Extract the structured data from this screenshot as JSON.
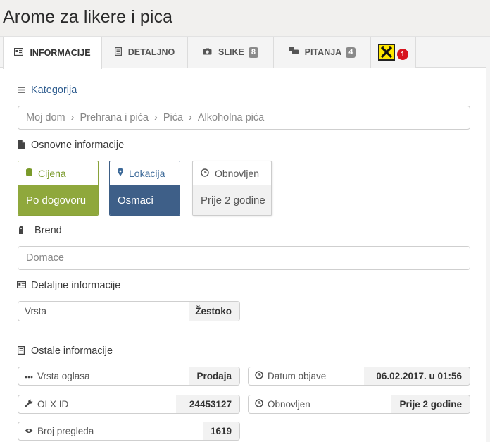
{
  "title": "Arome za likere i pica",
  "tabs": [
    {
      "label": "INFORMACIJE",
      "icon": "id-card-icon"
    },
    {
      "label": "DETALJNO",
      "icon": "document-icon"
    },
    {
      "label": "SLIKE",
      "icon": "camera-icon",
      "badge": "8"
    },
    {
      "label": "PITANJA",
      "icon": "chat-icon",
      "badge": "4"
    },
    {
      "label": "",
      "icon": "raiffeisen-logo-icon",
      "badge": "1"
    }
  ],
  "kategorija": {
    "label": "Kategorija",
    "breadcrumb": [
      "Moj dom",
      "Prehrana i pića",
      "Pića",
      "Alkoholna pića"
    ],
    "separator": "›"
  },
  "osnovne": {
    "label": "Osnovne informacije",
    "cijena": {
      "label": "Cijena",
      "value": "Po dogovoru"
    },
    "lokacija": {
      "label": "Lokacija",
      "value": "Osmaci"
    },
    "obnovljen": {
      "label": "Obnovljen",
      "value": "Prije 2 godine"
    }
  },
  "brend": {
    "label": "Brend",
    "placeholder": "Domace"
  },
  "detaljne": {
    "label": "Detaljne informacije",
    "vrsta": {
      "key": "Vrsta",
      "value": "Žestoko"
    }
  },
  "ostale": {
    "label": "Ostale informacije",
    "vrsta_oglasa": {
      "key": "Vrsta oglasa",
      "value": "Prodaja"
    },
    "datum_objave": {
      "key": "Datum objave",
      "value": "06.02.2017. u 01:56"
    },
    "olx_id": {
      "key": "OLX ID",
      "value": "24453127"
    },
    "obnovljen": {
      "key": "Obnovljen",
      "value": "Prije 2 godine"
    },
    "broj_pregleda": {
      "key": "Broj pregleda",
      "value": "1619"
    }
  },
  "colors": {
    "cijena_green": "#8fa83c",
    "lokacija_blue": "#3e5f88",
    "badge_red": "#d7141e",
    "raiffeisen_yellow": "#ffe600"
  }
}
